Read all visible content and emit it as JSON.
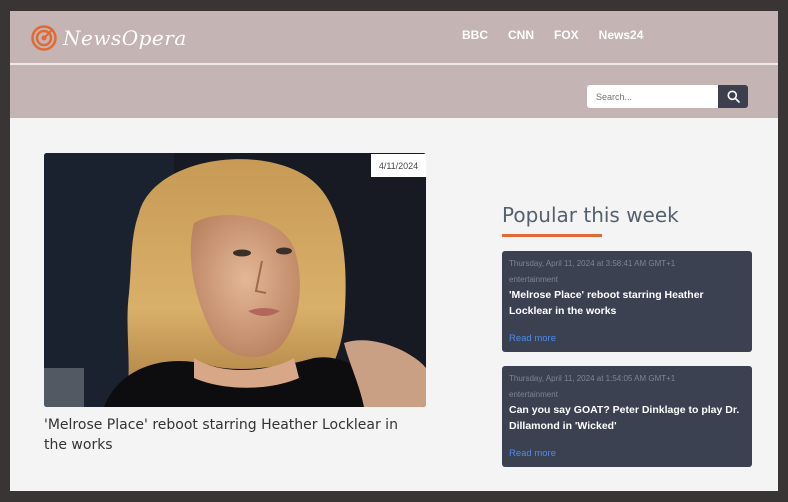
{
  "header": {
    "brand": "NewsOpera",
    "nav": [
      "BBC",
      "CNN",
      "FOX",
      "News24"
    ]
  },
  "search": {
    "placeholder": "Search..."
  },
  "hero": {
    "date": "4/11/2024",
    "title": "'Melrose Place' reboot starring Heather Locklear in the works"
  },
  "popular": {
    "heading": "Popular this week",
    "cards": [
      {
        "timestamp": "Thursday, April 11, 2024 at 3:58:41 AM GMT+1",
        "category": "entertainment",
        "title": "'Melrose Place' reboot starring Heather Locklear in the works",
        "link": "Read more"
      },
      {
        "timestamp": "Thursday, April 11, 2024 at 1:54:05 AM GMT+1",
        "category": "entertainment",
        "title": "Can you say GOAT? Peter Dinklage to play Dr. Dillamond in 'Wicked'",
        "link": "Read more"
      }
    ]
  },
  "colors": {
    "header_bg": "#c4b4b4",
    "accent": "#e06a35",
    "card_bg": "#3b4150",
    "link": "#4d8be8"
  }
}
